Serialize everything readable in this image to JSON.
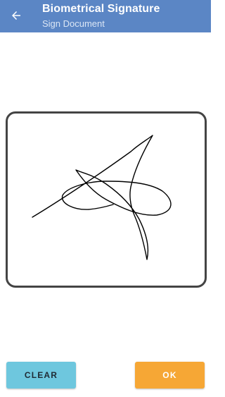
{
  "header": {
    "title": "Biometrical Signature",
    "subtitle": "Sign Document",
    "back_icon": "arrow-left-icon",
    "background_color": "#5b86c5"
  },
  "signature_pad": {
    "border_color": "#444444",
    "stroke_color": "#000000"
  },
  "actions": {
    "clear_label": "CLEAR",
    "clear_color": "#6ec7de",
    "ok_label": "OK",
    "ok_color": "#f6a735"
  }
}
